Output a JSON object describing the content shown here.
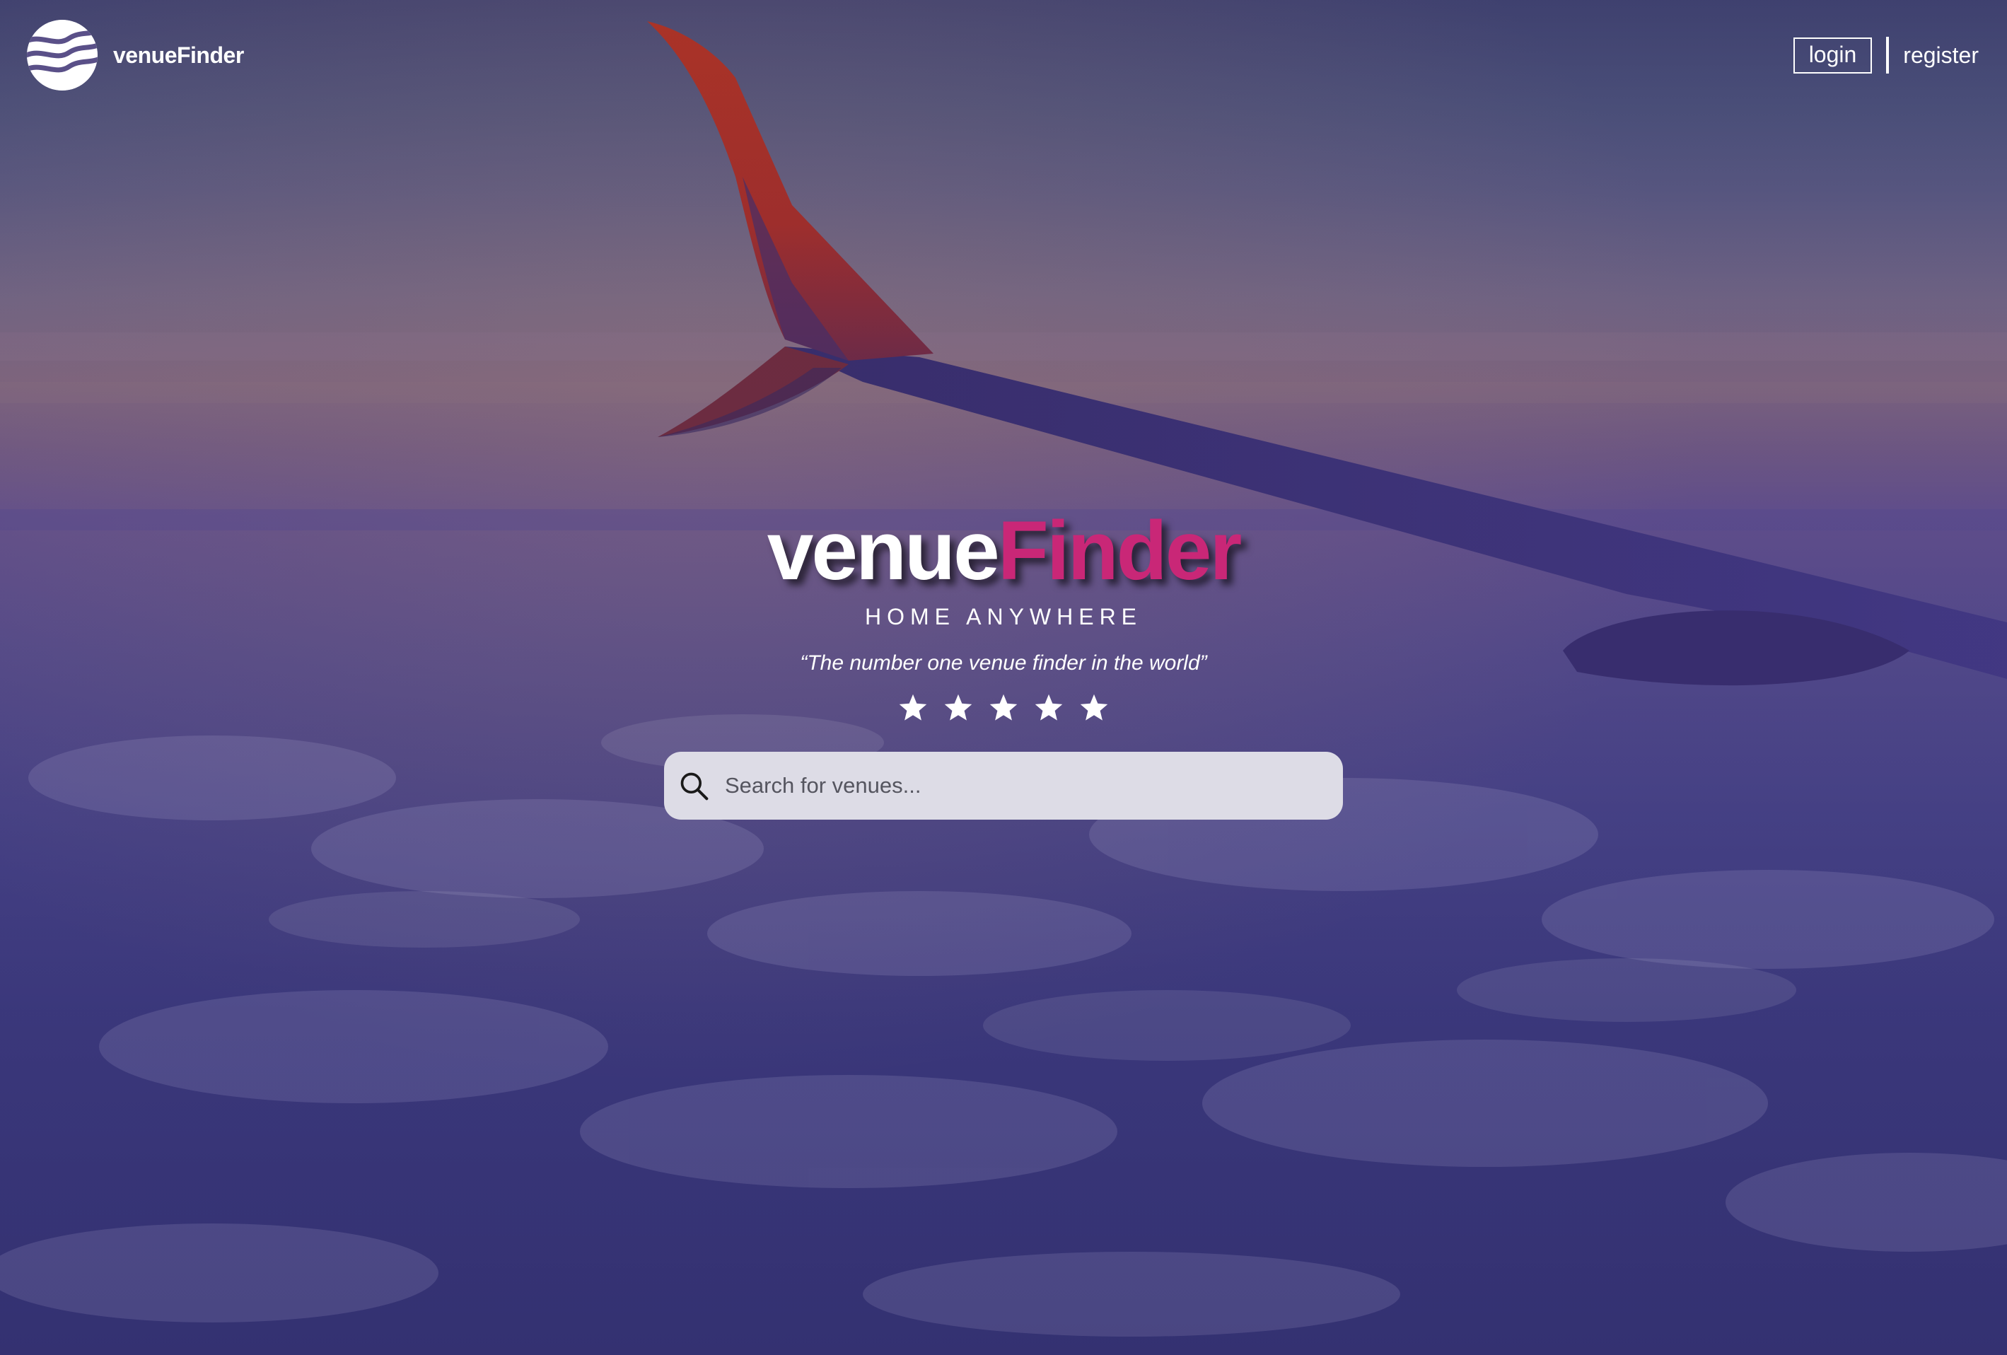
{
  "header": {
    "logo_text": "venueFinder",
    "login_label": "login",
    "register_label": "register"
  },
  "hero": {
    "brand_part1": "venue",
    "brand_part2": "Finder",
    "tagline": "HOME ANYWHERE",
    "quote": "“The number one venue finder in the world”",
    "rating": 5
  },
  "search": {
    "placeholder": "Search for venues..."
  },
  "colors": {
    "accent": "#c92777",
    "text": "#ffffff",
    "search_bg": "#dddce6"
  },
  "icons": {
    "logo": "wave-globe-icon",
    "search": "search-icon",
    "star": "star-icon"
  }
}
